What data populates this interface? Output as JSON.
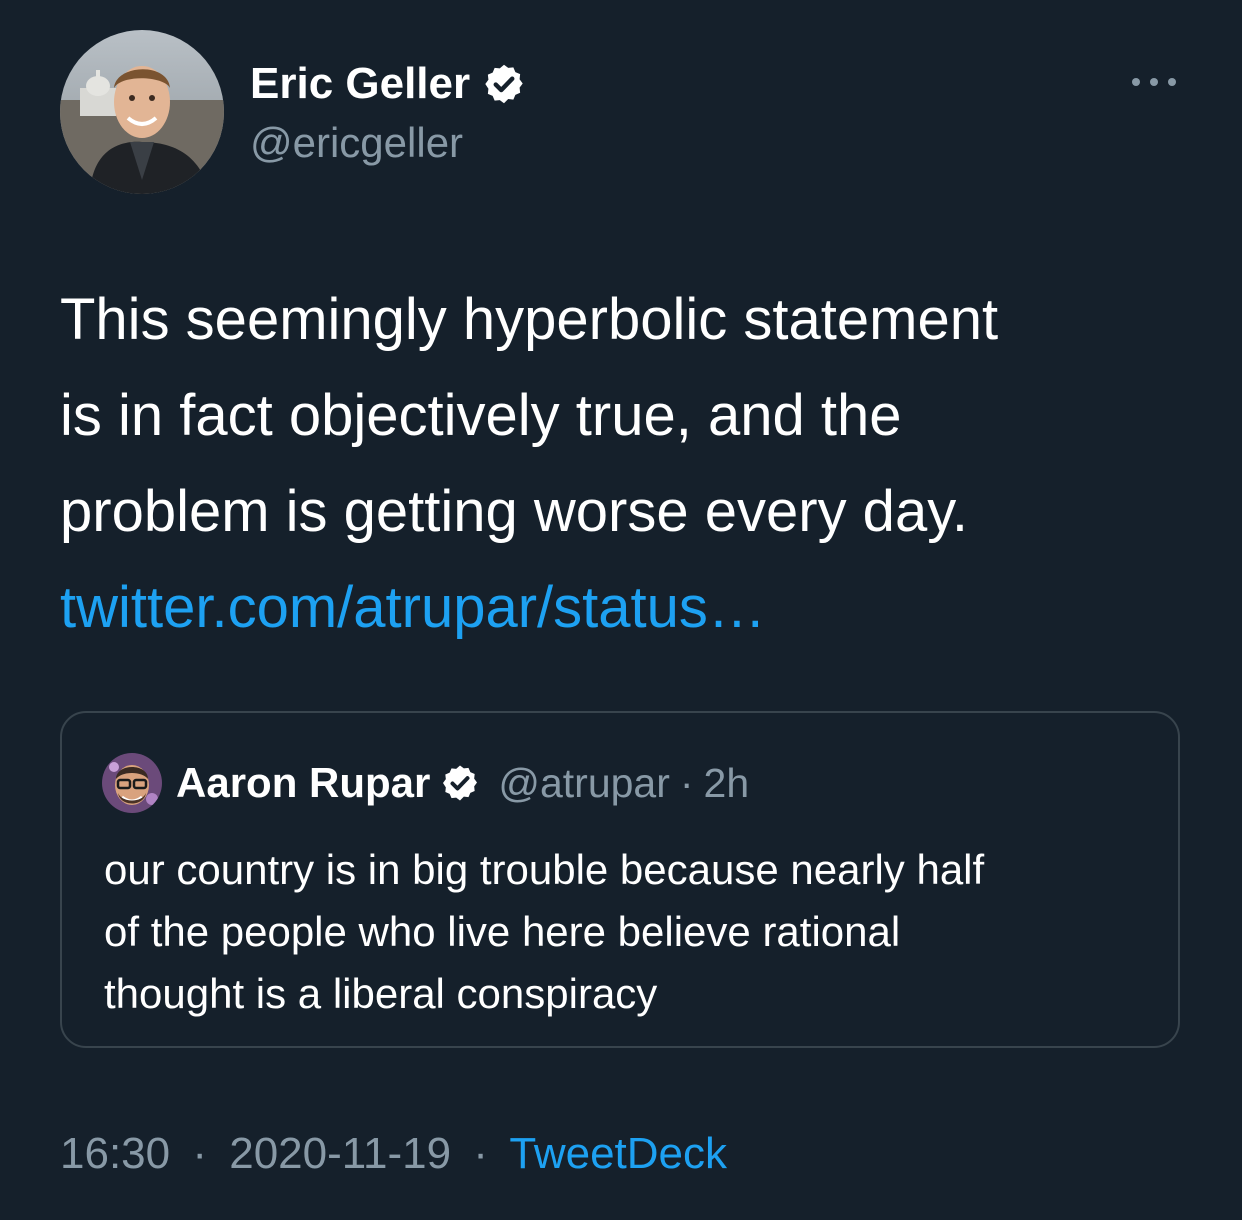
{
  "author": {
    "display_name": "Eric Geller",
    "handle": "@ericgeller",
    "verified": true
  },
  "tweet": {
    "lines": [
      "This seemingly hyperbolic statement",
      "is in fact objectively true, and the",
      "problem is getting worse every day."
    ],
    "link_text": "twitter.com/atrupar/status…"
  },
  "quoted": {
    "display_name": "Aaron Rupar",
    "handle": "@atrupar",
    "separator": "·",
    "age": "2h",
    "verified": true,
    "lines": [
      "our country is in big trouble because nearly half",
      "of the people who live here believe rational",
      "thought is a liberal conspiracy"
    ]
  },
  "footer": {
    "time": "16:30",
    "sep1": "·",
    "date": "2020-11-19",
    "sep2": "·",
    "source": "TweetDeck"
  },
  "icons": {
    "more": "more-horizontal-icon",
    "verified": "verified-badge-icon"
  },
  "colors": {
    "background": "#15202b",
    "link": "#1da1f2",
    "secondary_text": "#8899a6",
    "border": "#38444d"
  }
}
